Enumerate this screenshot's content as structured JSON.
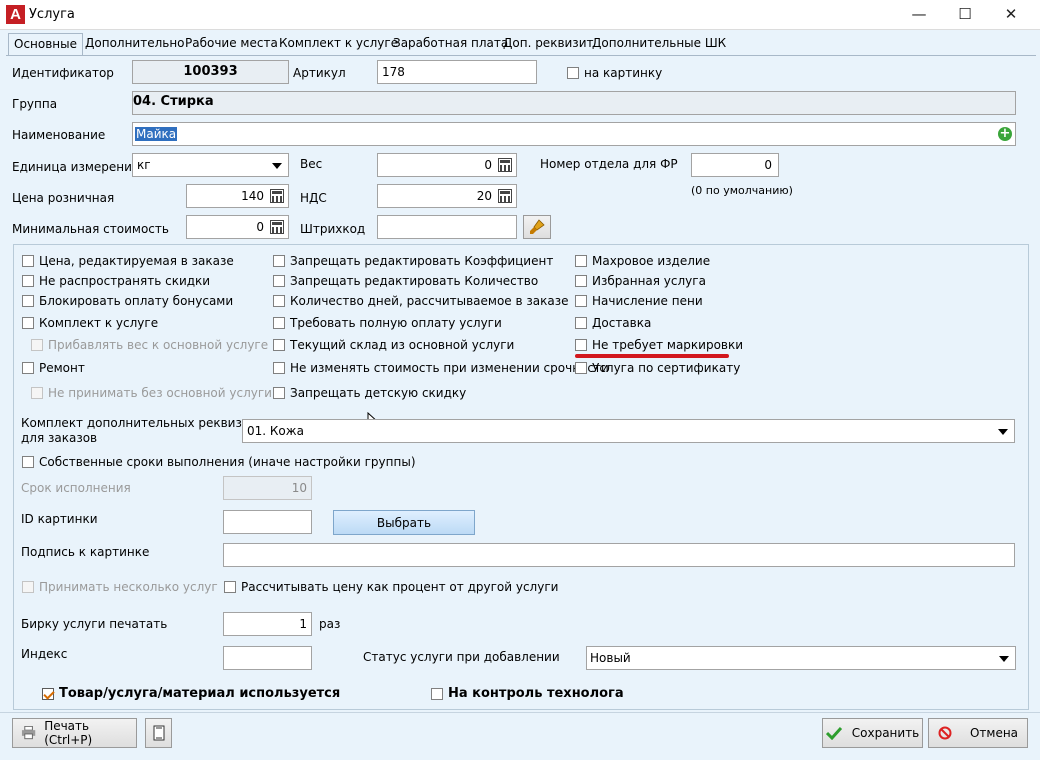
{
  "window": {
    "title": "Услуга",
    "app_icon_letter": "A",
    "minimize": "—",
    "maximize": "☐",
    "close": "✕"
  },
  "tabs": [
    "Основные",
    "Дополнительно",
    "Рабочие места",
    "Комплект к услуге",
    "Заработная плата",
    "Доп. реквизит",
    "Дополнительные ШК"
  ],
  "form": {
    "id_label": "Идентификатор",
    "id_value": "100393",
    "article_label": "Артикул",
    "article_value": "178",
    "on_picture_label": "на картинку",
    "group_label": "Группа",
    "group_value": "04. Стирка",
    "name_label": "Наименование",
    "name_value": "Майка",
    "unit_label": "Единица измерения",
    "unit_value": "кг",
    "weight_label": "Вес",
    "weight_value": "0",
    "dept_label": "Номер отдела для ФР",
    "dept_value": "0",
    "dept_hint": "(0 по умолчанию)",
    "price_label": "Цена розничная",
    "price_value": "140",
    "vat_label": "НДС",
    "vat_value": "20",
    "min_cost_label": "Минимальная стоимость",
    "min_cost_value": "0",
    "barcode_label": "Штрихкод",
    "barcode_value": ""
  },
  "checkboxes": {
    "col1": [
      "Цена, редактируемая в заказе",
      "Не распространять скидки",
      "Блокировать оплату бонусами",
      "Комплект к услуге",
      "Прибавлять вес к основной услуге",
      "Ремонт",
      "Не принимать без основной услуги"
    ],
    "col2": [
      "Запрещать редактировать Коэффициент",
      "Запрещать редактировать Количество",
      "Количество дней, рассчитываемое в заказе",
      "Требовать полную оплату услуги",
      "Текущий склад из основной услуги",
      "Не изменять стоимость при изменении срочности",
      "Запрещать детскую скидку"
    ],
    "col3": [
      "Махровое изделие",
      "Избранная услуга",
      "Начисление пени",
      "Доставка",
      "Не требует маркировки",
      "Услуга по сертификату"
    ]
  },
  "details": {
    "kit_label_line1": "Комплект дополнительных реквизитов",
    "kit_label_line2": "для заказов",
    "kit_value": "01. Кожа",
    "own_terms_label": "Собственные сроки выполнения (иначе настройки группы)",
    "term_label": "Срок исполнения",
    "term_value": "10",
    "picture_id_label": "ID картинки",
    "picture_id_value": "",
    "choose_button": "Выбрать",
    "caption_label": "Подпись к картинке",
    "caption_value": "",
    "multi_label": "Принимать несколько услуг",
    "percent_label": "Рассчитывать цену как процент от другой услуги",
    "tag_print_label": "Бирку услуги печатать",
    "tag_print_value": "1",
    "tag_print_unit": "раз",
    "index_label": "Индекс",
    "index_value": "",
    "status_label": "Статус услуги при добавлении",
    "status_value": "Новый"
  },
  "footer": {
    "used_label": "Товар/услуга/материал используется",
    "tech_label": "На контроль технолога",
    "print_button": "Печать (Ctrl+P)",
    "save_button": "Сохранить",
    "cancel_button": "Отмена"
  },
  "colors": {
    "accent_red": "#d2171d",
    "background": "#e9f3fb",
    "selection": "#2f6fbf"
  }
}
